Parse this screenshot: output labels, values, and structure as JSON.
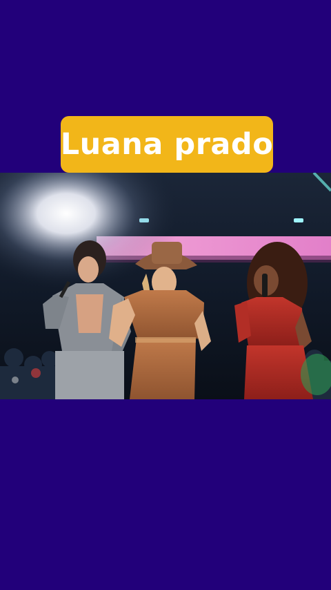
{
  "background_color": "#22007a",
  "banner": {
    "title": "Luana prado",
    "color": "#f2b619",
    "text_color": "#ffffff"
  },
  "video": {
    "scene": "concert-stage-three-performers"
  }
}
